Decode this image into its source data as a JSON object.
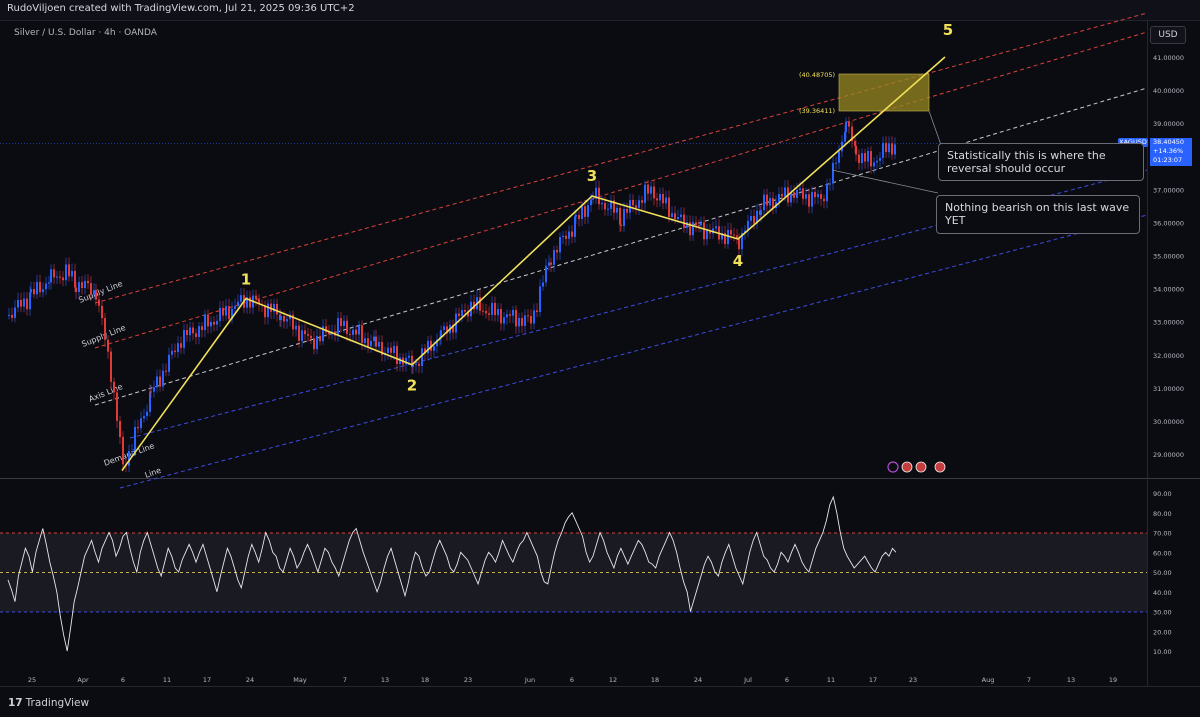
{
  "header": {
    "credit": "RudoViljoen created with TradingView.com, Jul 21, 2025 09:36 UTC+2",
    "symbol_line": "Silver / U.S. Dollar · 4h · OANDA",
    "currency_button": "USD"
  },
  "price_badge": {
    "ticker": "XAGUSD",
    "price": "38.40450",
    "change": "+14.36%",
    "countdown": "01:23:07"
  },
  "footer": {
    "brand": "TradingView"
  },
  "callouts": {
    "reversal": "Statistically this is where the reversal should occur",
    "bearish": "Nothing bearish on this last wave YET"
  },
  "colors": {
    "background": "#0b0b12",
    "wave": "#f0e05a",
    "candle_up": "#2962ff",
    "candle_down": "#e03a3a",
    "supply_line": "#d9433a",
    "axis_line": "#c9c9d0",
    "demand_line": "#3d4de0",
    "target_box": "#9a8a22",
    "rsi_line": "#e6e6ea"
  },
  "chart_data": [
    {
      "type": "line",
      "title": "Silver / U.S. Dollar · 4h · OANDA",
      "x_ticks": [
        "25",
        "Apr",
        "6",
        "11",
        "17",
        "24",
        "May",
        "7",
        "13",
        "18",
        "23",
        "Jun",
        "6",
        "12",
        "18",
        "24",
        "Jul",
        "6",
        "11",
        "17",
        "23",
        "Aug",
        "7",
        "13",
        "19"
      ],
      "y_ticks": [
        "29.00000",
        "30.00000",
        "31.00000",
        "32.00000",
        "33.00000",
        "34.00000",
        "35.00000",
        "36.00000",
        "37.00000",
        "38.00000",
        "39.00000",
        "40.00000",
        "41.00000"
      ],
      "ylim": [
        28.3,
        42.2
      ],
      "series": [
        {
          "name": "Wave count",
          "points": [
            {
              "x": "Apr 7",
              "y": 28.5
            },
            {
              "x": "Apr 24",
              "y": 33.7,
              "label": "1"
            },
            {
              "x": "May 15",
              "y": 31.7,
              "label": "2"
            },
            {
              "x": "Jun 9",
              "y": 36.8,
              "label": "3"
            },
            {
              "x": "Jul 1",
              "y": 35.5,
              "label": "4"
            },
            {
              "x": "Jul 29",
              "y": 41.0,
              "label": "5"
            }
          ]
        }
      ],
      "channel_labels": [
        "Supply Line",
        "Supply Line",
        "Axis Line",
        "Demand Line",
        "Line"
      ],
      "target_zone": {
        "low": 39.36411,
        "high": 40.48705,
        "low_label": "(39.36411)",
        "high_label": "(40.48705)"
      },
      "last_price": 38.4045
    },
    {
      "type": "line",
      "title": "",
      "y_ticks": [
        "10.00",
        "20.00",
        "30.00",
        "40.00",
        "50.00",
        "60.00",
        "70.00",
        "80.00",
        "90.00"
      ],
      "ylim": [
        0,
        95
      ],
      "levels": [
        30,
        50,
        70
      ],
      "series": [
        {
          "name": "",
          "values": [
            46,
            41,
            35,
            48,
            55,
            62,
            58,
            50,
            60,
            66,
            72,
            64,
            55,
            48,
            40,
            28,
            18,
            10,
            22,
            35,
            42,
            50,
            58,
            62,
            66,
            60,
            55,
            62,
            66,
            70,
            66,
            58,
            62,
            68,
            70,
            62,
            55,
            50,
            60,
            66,
            70,
            64,
            58,
            52,
            48,
            55,
            62,
            58,
            52,
            50,
            56,
            60,
            64,
            60,
            55,
            60,
            64,
            58,
            52,
            46,
            40,
            48,
            55,
            62,
            58,
            52,
            46,
            42,
            50,
            58,
            64,
            60,
            55,
            62,
            70,
            66,
            60,
            58,
            52,
            50,
            56,
            62,
            58,
            52,
            55,
            60,
            64,
            60,
            55,
            50,
            56,
            62,
            60,
            55,
            52,
            48,
            54,
            60,
            66,
            70,
            72,
            66,
            60,
            55,
            50,
            45,
            40,
            45,
            52,
            58,
            62,
            56,
            50,
            44,
            38,
            45,
            54,
            60,
            58,
            52,
            48,
            50,
            56,
            62,
            66,
            62,
            58,
            52,
            50,
            54,
            60,
            58,
            56,
            52,
            48,
            44,
            50,
            56,
            60,
            58,
            55,
            60,
            66,
            62,
            58,
            55,
            60,
            64,
            66,
            70,
            66,
            62,
            58,
            50,
            45,
            44,
            52,
            60,
            66,
            70,
            75,
            78,
            80,
            76,
            72,
            68,
            60,
            55,
            58,
            64,
            70,
            66,
            60,
            56,
            52,
            58,
            62,
            58,
            54,
            58,
            62,
            66,
            64,
            60,
            55,
            54,
            52,
            58,
            62,
            66,
            70,
            66,
            60,
            52,
            45,
            40,
            30,
            36,
            42,
            48,
            54,
            58,
            55,
            50,
            48,
            55,
            60,
            64,
            58,
            52,
            48,
            44,
            52,
            60,
            66,
            70,
            64,
            58,
            56,
            52,
            50,
            54,
            60,
            58,
            55,
            60,
            64,
            60,
            55,
            52,
            50,
            56,
            62,
            66,
            70,
            76,
            84,
            88,
            80,
            70,
            62,
            58,
            55,
            52,
            54,
            56,
            58,
            55,
            52,
            50,
            54,
            58,
            60,
            58,
            62,
            60
          ]
        }
      ]
    }
  ]
}
